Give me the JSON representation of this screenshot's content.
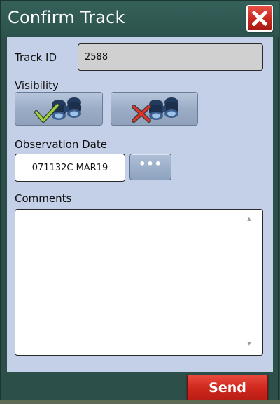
{
  "window": {
    "title": "Confirm Track",
    "close_icon": "close-x-icon"
  },
  "track": {
    "label": "Track ID",
    "value": "2588"
  },
  "visibility": {
    "label": "Visibility",
    "visible_icon": "binoculars-checkmark-icon",
    "not_visible_icon": "binoculars-cross-icon"
  },
  "observation": {
    "label": "Observation Date",
    "value": "071132C MAR19",
    "picker_label": "•••"
  },
  "comments": {
    "label": "Comments",
    "value": ""
  },
  "actions": {
    "send_label": "Send"
  },
  "colors": {
    "titlebar": "#2c524c",
    "panel": "#c3d0e8",
    "accent_red": "#d0281d"
  }
}
